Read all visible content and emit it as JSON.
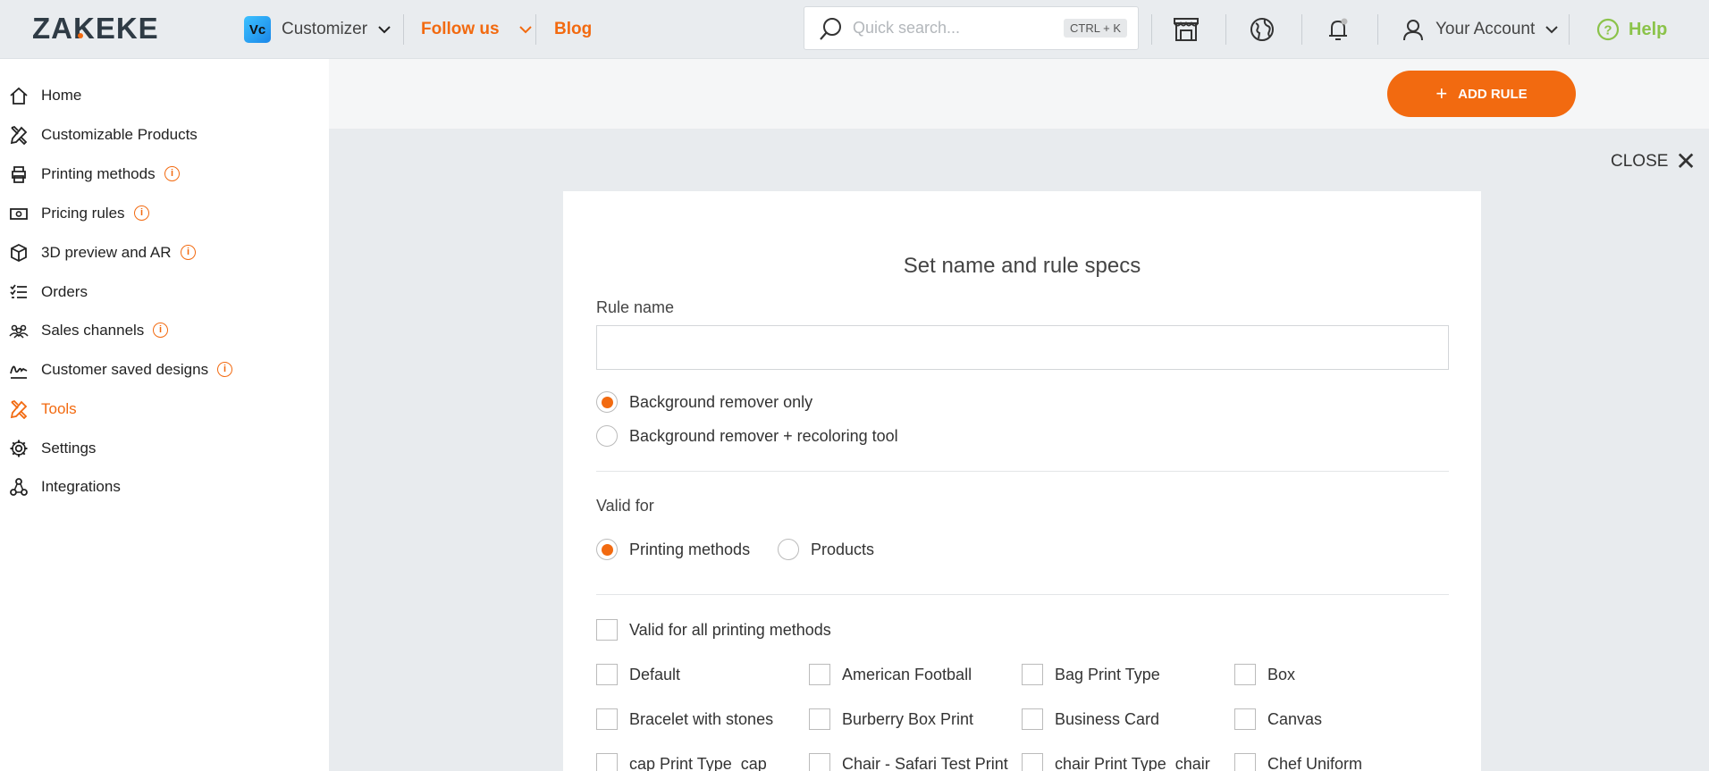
{
  "header": {
    "logo_text": "ZAKEKE",
    "app_badge": "Vc",
    "app_name": "Customizer",
    "follow_us": "Follow us",
    "blog": "Blog",
    "search_placeholder": "Quick search...",
    "search_shortcut": "CTRL + K",
    "account": "Your Account",
    "help": "Help"
  },
  "sidebar": {
    "items": [
      {
        "label": "Home",
        "icon": "home-icon",
        "info": false
      },
      {
        "label": "Customizable Products",
        "icon": "tools-icon",
        "info": false
      },
      {
        "label": "Printing methods",
        "icon": "printer-icon",
        "info": true
      },
      {
        "label": "Pricing rules",
        "icon": "money-icon",
        "info": true
      },
      {
        "label": "3D preview and AR",
        "icon": "cube-icon",
        "info": true
      },
      {
        "label": "Orders",
        "icon": "list-icon",
        "info": false
      },
      {
        "label": "Sales channels",
        "icon": "people-icon",
        "info": true
      },
      {
        "label": "Customer saved designs",
        "icon": "signature-icon",
        "info": true
      },
      {
        "label": "Tools",
        "icon": "tools-icon",
        "info": false,
        "active": true
      },
      {
        "label": "Settings",
        "icon": "gear-icon",
        "info": false
      },
      {
        "label": "Integrations",
        "icon": "integrations-icon",
        "info": false
      }
    ]
  },
  "main": {
    "add_rule": "ADD RULE",
    "close": "CLOSE"
  },
  "modal": {
    "title": "Set name and rule specs",
    "rule_name_label": "Rule name",
    "rule_name_value": "",
    "mode_options": [
      "Background remover only",
      "Background remover + recoloring tool"
    ],
    "mode_selected": 0,
    "valid_for_label": "Valid for",
    "valid_for_options": [
      "Printing methods",
      "Products"
    ],
    "valid_for_selected": 0,
    "all_methods_label": "Valid for all printing methods",
    "methods": [
      "Default",
      "American Football",
      "Bag Print Type",
      "Box",
      "Bracelet with stones",
      "Burberry Box Print",
      "Business Card",
      "Canvas",
      "cap Print Type_cap",
      "Chair - Safari Test Print",
      "chair Print Type_chair",
      "Chef Uniform"
    ]
  },
  "colors": {
    "accent": "#f26a10",
    "help": "#8bc34a",
    "overlay": "#e8ebee"
  }
}
